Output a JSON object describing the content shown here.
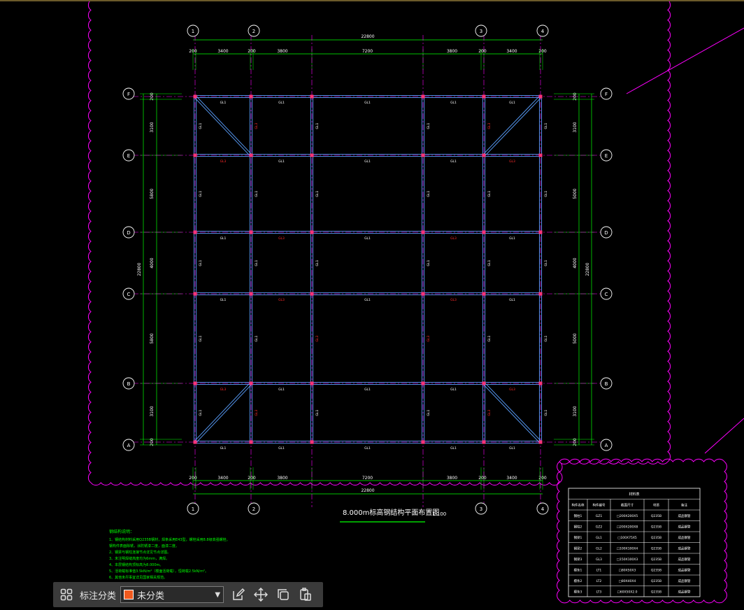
{
  "drawing": {
    "title": "8.000m标高钢结构平面布置图",
    "scale": "1:100",
    "total_dim": "22800",
    "h_spans": [
      "200",
      "3400",
      "200",
      "3800",
      "7200",
      "3800",
      "200",
      "3400",
      "200"
    ],
    "v_spans": [
      "200",
      "3100",
      "5800",
      "4000",
      "5800",
      "3100",
      "200"
    ],
    "v_spans_right": [
      "200",
      "3100",
      "5000",
      "4000",
      "5000",
      "3100",
      "200"
    ],
    "axis_cols": [
      "1",
      "2",
      "3",
      "4"
    ],
    "axis_rows": [
      "F",
      "E",
      "D",
      "C",
      "B",
      "A"
    ],
    "beam_label": "GL1",
    "beam_label_red": "GL3",
    "beam_label_red2": "GL2",
    "notes_title": "钢结构说明：",
    "notes": [
      "1、钢结构材料采用Q235B钢材，焊条采用E43型，螺栓采用8.8级高强螺栓。",
      "   钢构件表面除锈，涂防锈漆二度，面漆二度。",
      "2、钢梁与钢柱连接节点详见节点详图。",
      "3、未注明焊缝高度均为6mm，满焊。",
      "4、本层钢结构顶标高为8.000m。",
      "5、活荷载标准值3.5kN/m²（楼面活荷载），恒荷载2.5kN/m²。",
      "6、其他未尽事宜详见国家相关规范。"
    ]
  },
  "material_table": {
    "title": "材料表",
    "headers": [
      "构件名称",
      "构件编号",
      "截面尺寸",
      "材质",
      "备注"
    ],
    "rows": [
      [
        "钢柱1",
        "GZ1",
        "□200X200X5",
        "Q235B",
        "成品钢管"
      ],
      [
        "钢柱2",
        "GZ2",
        "□200X200X8",
        "Q235B",
        "成品钢管"
      ],
      [
        "钢梁1",
        "GL1",
        "□100X75X5",
        "Q235B",
        "成品钢管"
      ],
      [
        "钢梁2",
        "GL2",
        "□100X100X4",
        "Q235B",
        "成品钢管"
      ],
      [
        "钢梁3",
        "GL3",
        "□150X100X3",
        "Q235B",
        "成品钢管"
      ],
      [
        "檩条1",
        "LT1",
        "□80X50X3",
        "Q235B",
        "成品钢管"
      ],
      [
        "檩条2",
        "LT2",
        "□80X40X4",
        "Q235B",
        "成品钢管"
      ],
      [
        "檩条3",
        "LT3",
        "□60X50X2.0",
        "Q235B",
        "成品钢管"
      ]
    ]
  },
  "toolbar": {
    "label": "标注分类",
    "selected": "未分类",
    "swatch_color": "#f05a1e"
  }
}
